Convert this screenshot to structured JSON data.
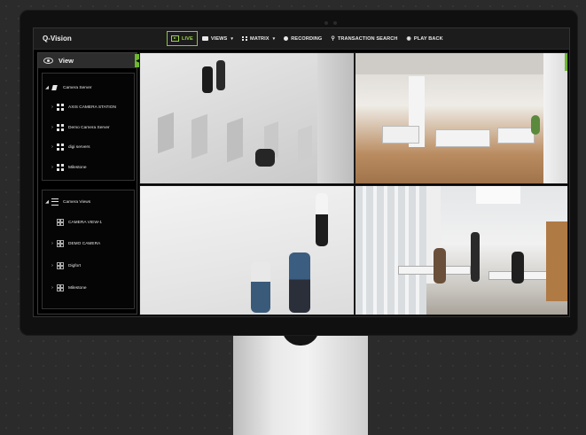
{
  "app": {
    "title": "Q-Vision"
  },
  "nav": {
    "live": "LIVE",
    "views": "VIEWS",
    "matrix": "MATRIX",
    "recording": "RECORDING",
    "transaction_search": "TRANSACTION SEARCH",
    "play_back": "PLAY BACK"
  },
  "sidebar": {
    "title": "View",
    "server_group": {
      "label": "Camera Server",
      "items": [
        {
          "label": "AXIS CAMERA STATION"
        },
        {
          "label": "Demo Camera Server"
        },
        {
          "label": "digi servers"
        },
        {
          "label": "Milestone"
        }
      ]
    },
    "views_group": {
      "label": "Camera Views",
      "items": [
        {
          "label": "CAMERA VIEW-1"
        },
        {
          "label": "DEMO CAMERA"
        },
        {
          "label": "Digfort"
        },
        {
          "label": "Milestone"
        }
      ]
    }
  },
  "colors": {
    "accent": "#8bc53f",
    "background": "#000000",
    "panel": "#2d2d2d"
  }
}
